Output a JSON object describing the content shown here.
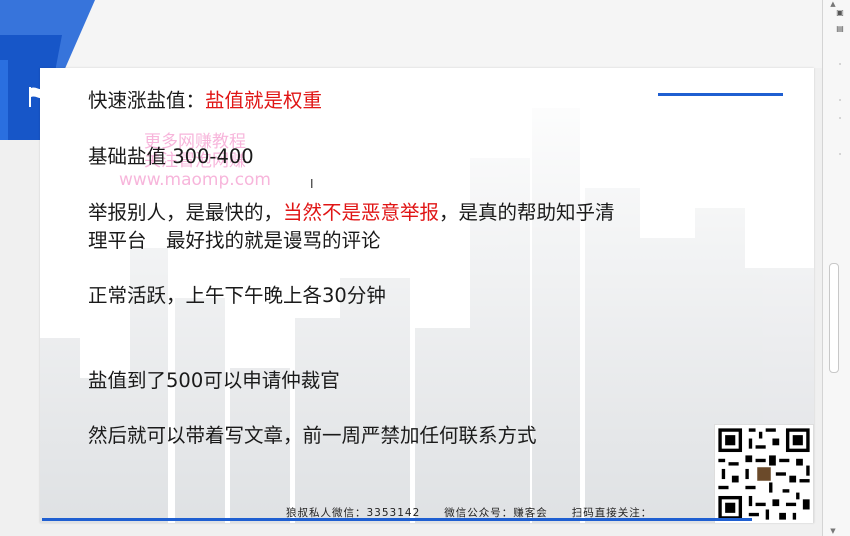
{
  "slide": {
    "line1_prefix": "快速涨盐值：",
    "line1_highlight": "盐值就是权重",
    "line2": "基础盐值 300-400",
    "line3_prefix": "举报别人，是最快的，",
    "line3_highlight": "当然不是恶意举报",
    "line3_suffix": "，是真的帮助知乎清",
    "line4": "理平台　最好找的就是谩骂的评论",
    "line5": "正常活跃，上午下午晚上各30分钟",
    "line6": "盐值到了500可以申请仲裁官",
    "line7": "然后就可以带着写文章，前一周严禁加任何联系方式"
  },
  "footer": {
    "contact": "狼叔私人微信：3353142",
    "official": "微信公众号：赚客会",
    "scan": "扫码直接关注："
  },
  "watermark": {
    "line1": "更多网赚教程",
    "line2": "关注冒泡网赚",
    "line3": "www.maomp.com"
  },
  "colors": {
    "accent": "#1f5fd1",
    "highlight": "#e01515"
  },
  "icons": {
    "flag": "flag-icon",
    "cursor": "text-cursor-icon",
    "qr": "qr-code-icon"
  }
}
